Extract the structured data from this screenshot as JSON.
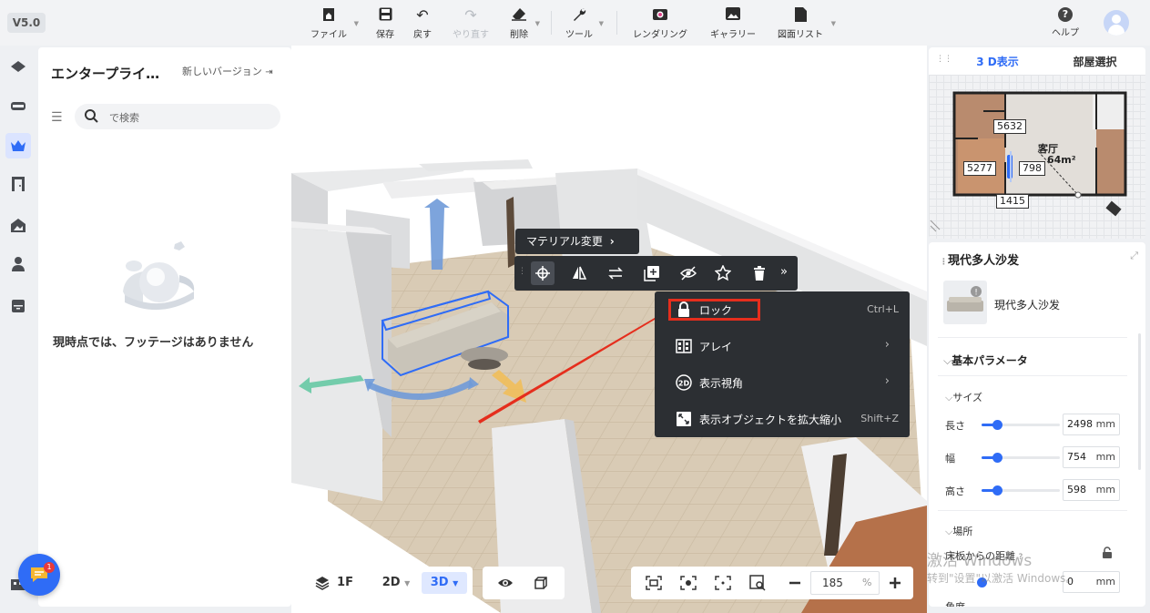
{
  "app": {
    "version": "V5.0"
  },
  "toolbar": {
    "file": "ファイル",
    "save": "保存",
    "undo": "戻す",
    "redo": "やり直す",
    "delete": "削除",
    "tools": "ツール",
    "render": "レンダリング",
    "gallery": "ギャラリー",
    "drawing_list": "図面リスト",
    "help": "ヘルプ"
  },
  "left_panel": {
    "title": "エンタープライ…",
    "new_version": "新しいバージョン",
    "search_placeholder": "で検索",
    "empty_message": "現時点では、フッテージはありません"
  },
  "selection_toolbar": {
    "material_change": "マテリアル変更"
  },
  "context_menu": {
    "items": [
      {
        "label": "ロック",
        "shortcut": "Ctrl+L",
        "icon": "lock-icon"
      },
      {
        "label": "アレイ",
        "icon": "array-icon",
        "has_submenu": true
      },
      {
        "label": "表示視角",
        "icon": "view-angle-icon",
        "has_submenu": true
      },
      {
        "label": "表示オブジェクトを拡大縮小",
        "shortcut": "Shift+Z",
        "icon": "zoom-fit-icon"
      }
    ]
  },
  "bottom": {
    "floor": "1F",
    "mode_2d": "2D",
    "mode_3d": "3D",
    "zoom_value": "185",
    "zoom_unit": "%"
  },
  "right_panel": {
    "tabs": [
      "3 D表示",
      "部屋選択"
    ],
    "minimap": {
      "dim_top": "5632",
      "dim_left": "5277",
      "dim_mid": "798",
      "dim_bottom": "1415",
      "room_name": "客厅",
      "room_area": "64m²"
    },
    "object_title": "現代多人沙发",
    "object_name": "現代多人沙发",
    "section_basic": "基本パラメータ",
    "sub_size": "サイズ",
    "length_label": "長さ",
    "length_value": "2498",
    "length_fraction": 0.2,
    "width_label": "幅",
    "width_value": "754",
    "width_fraction": 0.2,
    "height_label": "高さ",
    "height_value": "598",
    "height_fraction": 0.2,
    "unit": "mm",
    "sub_location": "場所",
    "floor_distance_label": "床板からの距離",
    "floor_distance_value": "0",
    "angle_label": "角度"
  },
  "watermark": {
    "line1": "激活 Windows",
    "line2": "转到\"设置\"以激活 Windows。"
  },
  "chat": {
    "badge": "1"
  }
}
